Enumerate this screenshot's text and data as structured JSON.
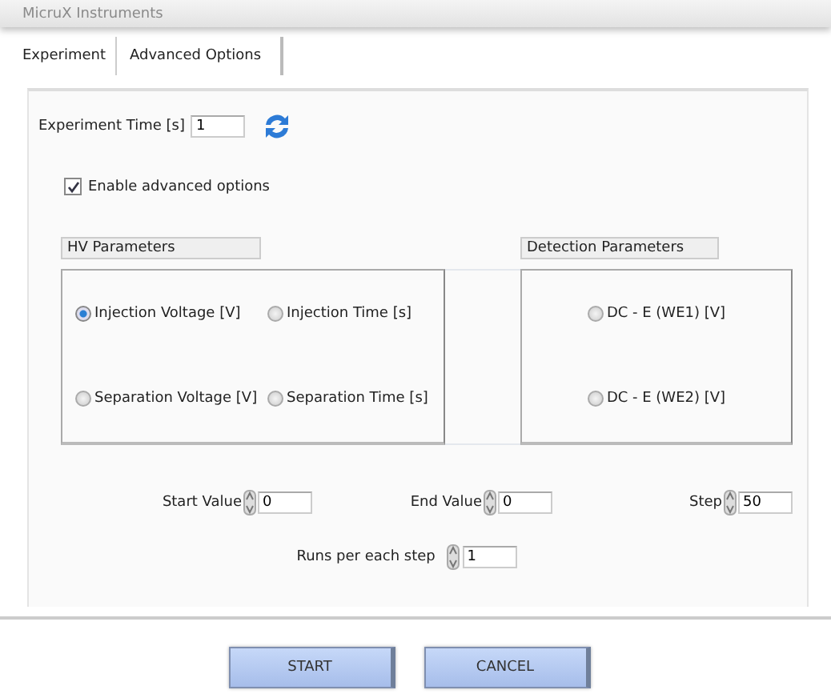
{
  "window": {
    "title": "MicruX Instruments"
  },
  "tabs": [
    {
      "label": "Experiment",
      "selected": false
    },
    {
      "label": "Advanced Options",
      "selected": true
    }
  ],
  "experiment_time": {
    "label": "Experiment Time [s]",
    "value": "1"
  },
  "enable_advanced": {
    "label": "Enable advanced options",
    "checked": true
  },
  "hv_parameters": {
    "title": "HV Parameters",
    "options": [
      {
        "label": "Injection Voltage [V]",
        "selected": true
      },
      {
        "label": "Injection Time [s]",
        "selected": false
      },
      {
        "label": "Separation Voltage [V]",
        "selected": false
      },
      {
        "label": "Separation Time [s]",
        "selected": false
      }
    ]
  },
  "detection_parameters": {
    "title": "Detection Parameters",
    "options": [
      {
        "label": "DC - E (WE1) [V]",
        "selected": false
      },
      {
        "label": "DC - E (WE2) [V]",
        "selected": false
      }
    ]
  },
  "sweep": [
    {
      "label": "Start Value",
      "value": "0"
    },
    {
      "label": "End Value",
      "value": "0"
    },
    {
      "label": "Step",
      "value": "50"
    }
  ],
  "runs": {
    "label": "Runs per each step",
    "value": "1"
  },
  "buttons": [
    "START",
    "CANCEL"
  ]
}
